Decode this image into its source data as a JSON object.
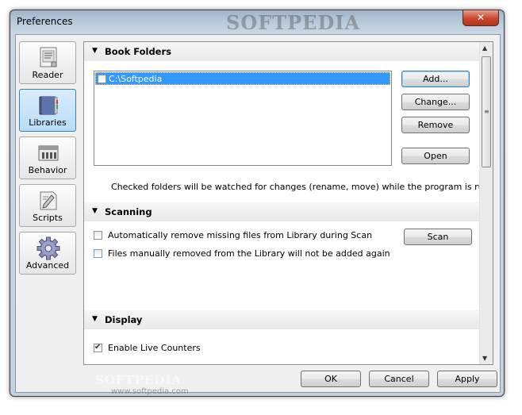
{
  "window": {
    "title": "Preferences",
    "watermark": "SOFTPEDIA",
    "close_glyph": "✕"
  },
  "sidebar": {
    "items": [
      {
        "label": "Reader",
        "icon": "reader-icon",
        "active": false
      },
      {
        "label": "Libraries",
        "icon": "books-icon",
        "active": true
      },
      {
        "label": "Behavior",
        "icon": "behavior-icon",
        "active": false
      },
      {
        "label": "Scripts",
        "icon": "scripts-icon",
        "active": false
      },
      {
        "label": "Advanced",
        "icon": "gear-icon",
        "active": false
      }
    ]
  },
  "book_folders": {
    "heading": "Book Folders",
    "folders": [
      {
        "path": "C:\\Softpedia",
        "checked": false,
        "selected": true
      }
    ],
    "buttons": {
      "add": "Add...",
      "change": "Change...",
      "remove": "Remove",
      "open": "Open"
    },
    "note": "Checked folders will be watched for changes (rename, move) while the program is running."
  },
  "scanning": {
    "heading": "Scanning",
    "options": [
      {
        "label": "Automatically remove missing files from Library during Scan",
        "checked": false
      },
      {
        "label": "Files manually removed from the Library will not be added again",
        "checked": false
      }
    ],
    "scan_button": "Scan"
  },
  "display": {
    "heading": "Display",
    "options": [
      {
        "label": "Enable Live Counters",
        "checked": true
      }
    ]
  },
  "footer": {
    "ok": "OK",
    "cancel": "Cancel",
    "apply": "Apply"
  },
  "watermark_url": "www.softpedia.com"
}
